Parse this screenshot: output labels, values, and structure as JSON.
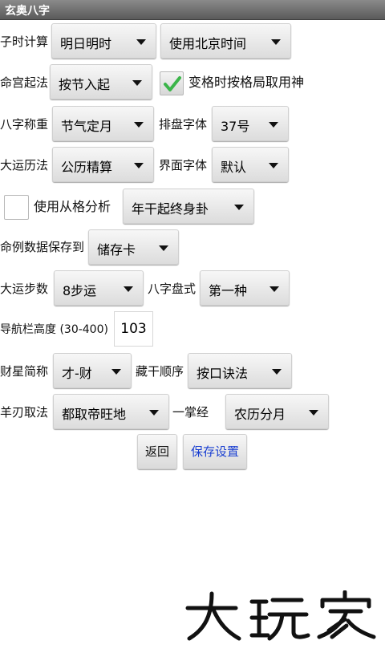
{
  "app": {
    "title": "玄奥八字"
  },
  "rows": {
    "zishi": {
      "label": "子时计算",
      "option1": "明日明时",
      "option2": "使用北京时间"
    },
    "minggong": {
      "label": "命宫起法",
      "select": "按节入起",
      "checkbox_label": "变格时按格局取用神",
      "checkbox_checked": true
    },
    "bazi_weight": {
      "label": "八字称重",
      "select": "节气定月",
      "font_label": "排盘字体",
      "font_value": "37号"
    },
    "dayun_calendar": {
      "label": "大运历法",
      "select": "公历精算",
      "ui_font_label": "界面字体",
      "ui_font_value": "默认"
    },
    "congge": {
      "checkbox_label": "使用从格分析",
      "checkbox_checked": false,
      "select": "年干起终身卦"
    },
    "save_location": {
      "label": "命例数据保存到",
      "select": "储存卡"
    },
    "dayun_steps": {
      "label": "大运步数",
      "select": "8步运",
      "layout_label": "八字盘式",
      "layout_value": "第一种"
    },
    "navbar_height": {
      "label": "导航栏高度 (30-400)",
      "value": "103"
    },
    "caixing": {
      "label": "财星简称",
      "select": "才-财",
      "canggan_label": "藏干顺序",
      "canggan_value": "按口诀法"
    },
    "yangren": {
      "label": "羊刃取法",
      "select": "都取帝旺地",
      "yizhang_label": "一掌经",
      "yizhang_value": "农历分月"
    }
  },
  "buttons": {
    "back": "返回",
    "save": "保存设置"
  },
  "watermark": {
    "text": "大玩家"
  },
  "colors": {
    "title_bg": "#6e6e6e",
    "check_green": "#3bb54a",
    "save_text": "#1a3fd1"
  }
}
